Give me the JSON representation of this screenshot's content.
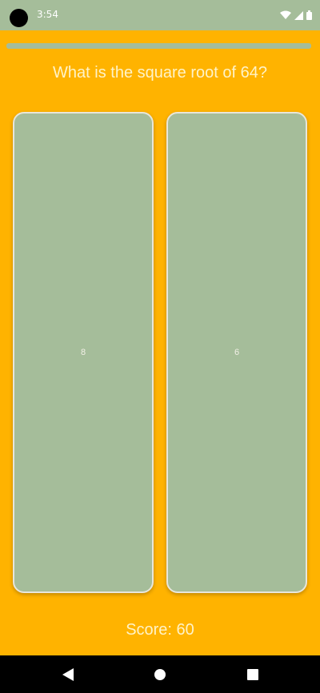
{
  "status": {
    "time": "3:54"
  },
  "quiz": {
    "question": "What is the square root of 64?",
    "progress_fraction": 1.0,
    "answers": [
      {
        "label": "8"
      },
      {
        "label": "6"
      }
    ],
    "score_text": "Score: 60"
  },
  "colors": {
    "background": "#FFB300",
    "card": "#A5BD9A",
    "text": "#FFF3C8"
  },
  "icons": {
    "status": [
      "wifi-icon",
      "signal-icon",
      "battery-icon"
    ],
    "nav": [
      "back-icon",
      "home-icon",
      "recent-apps-icon"
    ]
  }
}
